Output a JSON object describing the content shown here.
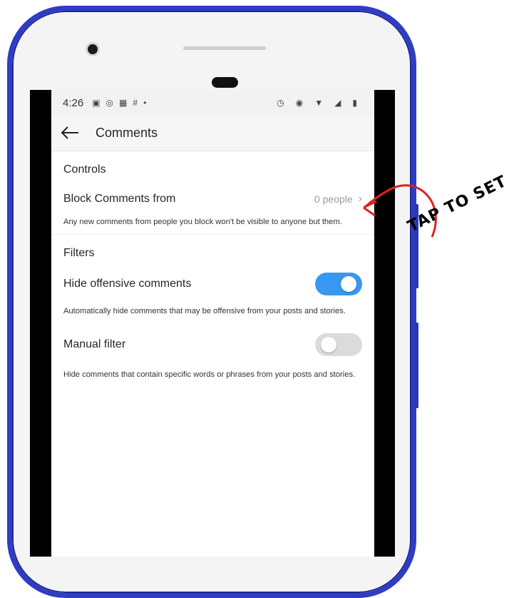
{
  "status_bar": {
    "time": "4:26"
  },
  "header": {
    "title": "Comments",
    "back_icon": "arrow-left-icon"
  },
  "sections": {
    "controls": {
      "heading": "Controls",
      "block_row": {
        "label": "Block Comments from",
        "value": "0 people"
      },
      "description": "Any new comments from people you block won't be visible to anyone but them."
    },
    "filters": {
      "heading": "Filters",
      "hide_offensive": {
        "label": "Hide offensive comments",
        "enabled": true,
        "description": "Automatically hide comments that may be offensive from your posts and stories."
      },
      "manual_filter": {
        "label": "Manual filter",
        "enabled": false,
        "description": "Hide comments that contain specific words or phrases from your posts and stories."
      }
    }
  },
  "annotation": {
    "text": "TAP TO SET",
    "arrow_color": "#e02020"
  },
  "colors": {
    "phone_frame": "#2f3cc4",
    "toggle_on": "#3897f0",
    "toggle_off": "#dbdbdb"
  }
}
